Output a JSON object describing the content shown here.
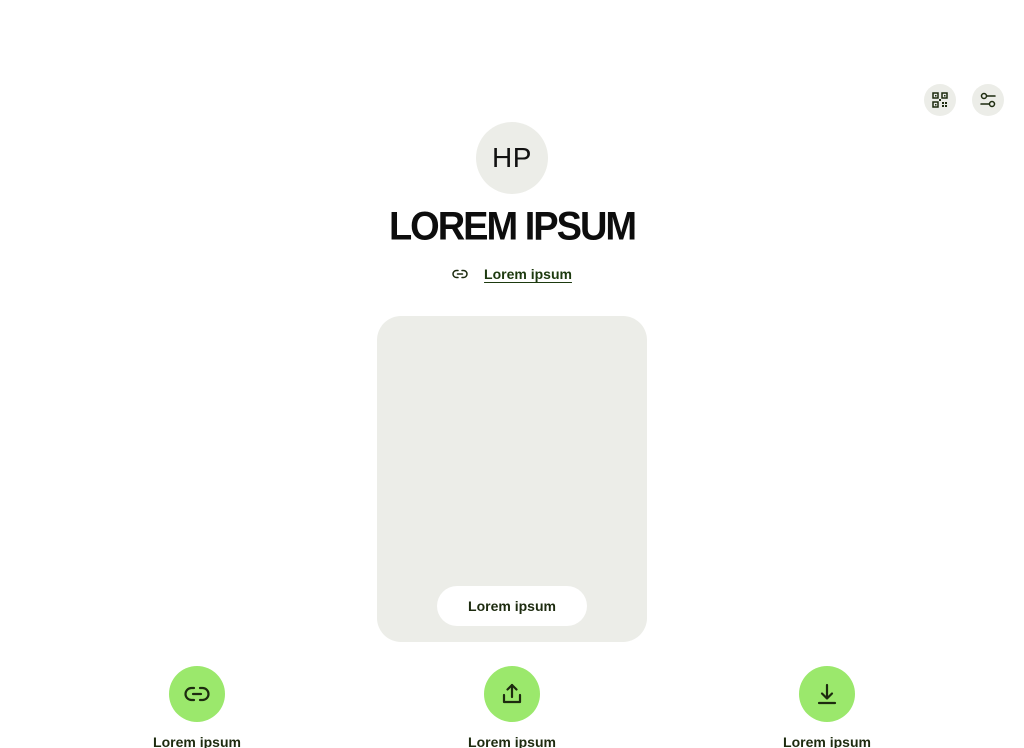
{
  "header": {
    "qr_icon": "qr-code-icon",
    "settings_icon": "sliders-icon"
  },
  "profile": {
    "initials": "HP",
    "name": "LOREM IPSUM",
    "link_label": "Lorem ipsum",
    "link_icon": "link-icon"
  },
  "card": {
    "button_label": "Lorem ipsum"
  },
  "actions": [
    {
      "label": "Lorem ipsum",
      "icon": "link-icon"
    },
    {
      "label": "Lorem ipsum",
      "icon": "share-icon"
    },
    {
      "label": "Lorem ipsum",
      "icon": "download-icon"
    }
  ],
  "colors": {
    "accent": "#9be86c",
    "surface": "#ecede8",
    "text": "#1d2b0f"
  }
}
